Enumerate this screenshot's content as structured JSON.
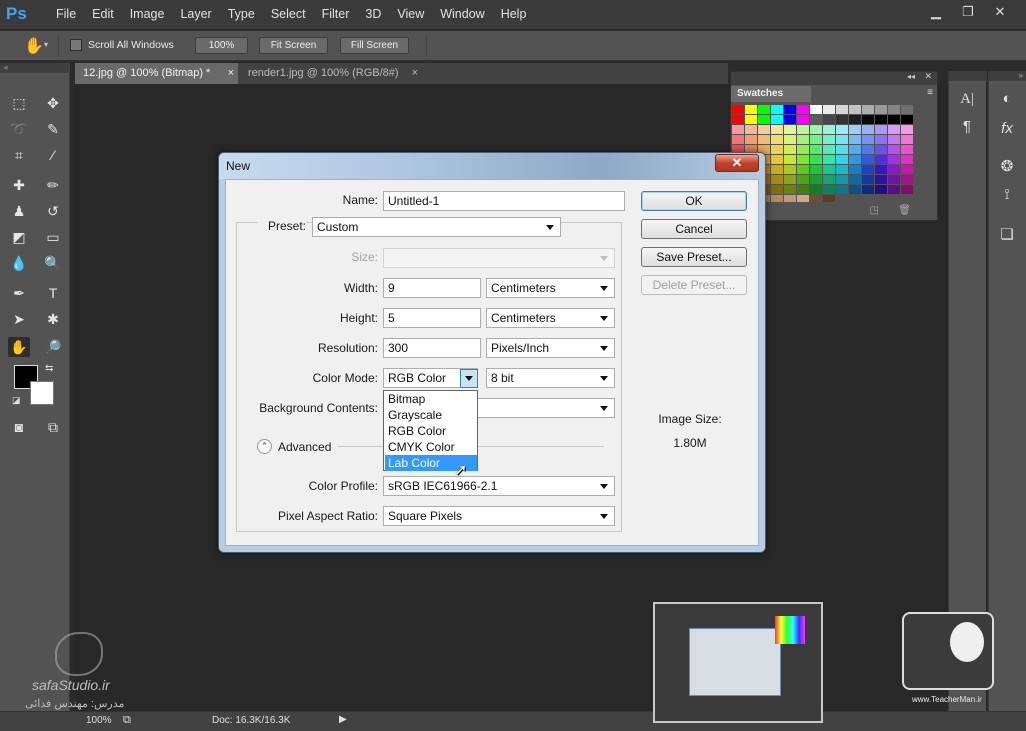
{
  "app": {
    "logo": "Ps",
    "menus": [
      "File",
      "Edit",
      "Image",
      "Layer",
      "Type",
      "Select",
      "Filter",
      "3D",
      "View",
      "Window",
      "Help"
    ]
  },
  "options": {
    "scroll_all_windows": "Scroll All Windows",
    "zoom_100": "100%",
    "fit_screen": "Fit Screen",
    "fill_screen": "Fill Screen"
  },
  "tabs": [
    {
      "label": "12.jpg @ 100% (Bitmap) *",
      "close": "×"
    },
    {
      "label": "render1.jpg @ 100% (RGB/8#)",
      "close": "×"
    }
  ],
  "swatches": {
    "title": "Swatches"
  },
  "status": {
    "zoom": "100%",
    "doc": "Doc: 16.3K/16.3K"
  },
  "watermark": {
    "left_site": "safaStudio.ir",
    "left_sub": "مدرس: مهندس فدائی",
    "right_site": "www.TeacherMan.ir"
  },
  "dialog": {
    "title": "New",
    "close": "✕",
    "name_label": "Name:",
    "name_value": "Untitled-1",
    "preset_label": "Preset:",
    "preset_value": "Custom",
    "size_label": "Size:",
    "width_label": "Width:",
    "width_value": "9",
    "width_unit": "Centimeters",
    "height_label": "Height:",
    "height_value": "5",
    "height_unit": "Centimeters",
    "resolution_label": "Resolution:",
    "resolution_value": "300",
    "resolution_unit": "Pixels/Inch",
    "color_mode_label": "Color Mode:",
    "color_mode_value": "RGB Color",
    "bit_depth": "8 bit",
    "background_label": "Background Contents:",
    "advanced_label": "Advanced",
    "color_profile_label": "Color Profile:",
    "color_profile_value": "sRGB IEC61966-2.1",
    "pixel_aspect_label": "Pixel Aspect Ratio:",
    "pixel_aspect_value": "Square Pixels",
    "ok": "OK",
    "cancel": "Cancel",
    "save_preset": "Save Preset...",
    "delete_preset": "Delete Preset...",
    "image_size_label": "Image Size:",
    "image_size_value": "1.80M",
    "color_mode_options": [
      "Bitmap",
      "Grayscale",
      "RGB Color",
      "CMYK Color",
      "Lab Color"
    ],
    "selected_option": "Lab Color"
  }
}
